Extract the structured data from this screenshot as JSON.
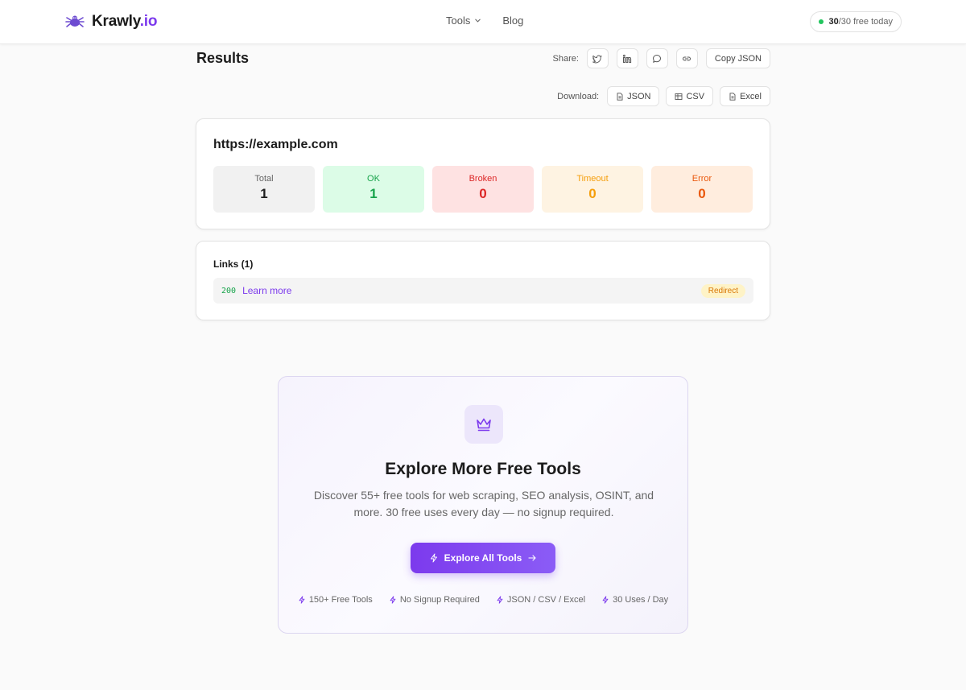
{
  "header": {
    "brand_name": "Krawly",
    "brand_suffix": ".io",
    "nav": {
      "tools": "Tools",
      "blog": "Blog"
    },
    "quota_used": "30",
    "quota_rest": "/30 free today"
  },
  "results": {
    "title": "Results",
    "share_label": "Share:",
    "copy_json": "Copy JSON",
    "download_label": "Download:",
    "downloads": {
      "json": "JSON",
      "csv": "CSV",
      "excel": "Excel"
    }
  },
  "summary": {
    "url": "https://example.com",
    "stats": {
      "total": {
        "label": "Total",
        "value": "1"
      },
      "ok": {
        "label": "OK",
        "value": "1"
      },
      "broken": {
        "label": "Broken",
        "value": "0"
      },
      "timeout": {
        "label": "Timeout",
        "value": "0"
      },
      "error": {
        "label": "Error",
        "value": "0"
      }
    }
  },
  "links": {
    "title": "Links (1)",
    "items": [
      {
        "code": "200",
        "text": "Learn more",
        "badge": "Redirect"
      }
    ]
  },
  "promo": {
    "title": "Explore More Free Tools",
    "description": "Discover 55+ free tools for web scraping, SEO analysis, OSINT, and more. 30 free uses every day — no signup required.",
    "button": "Explore All Tools",
    "features": [
      "150+ Free Tools",
      "No Signup Required",
      "JSON / CSV / Excel",
      "30 Uses / Day"
    ]
  },
  "colors": {
    "accent": "#7c3aed",
    "ok": "#16a34a",
    "broken": "#dc2626",
    "timeout": "#f59e0b",
    "error": "#ea580c"
  }
}
